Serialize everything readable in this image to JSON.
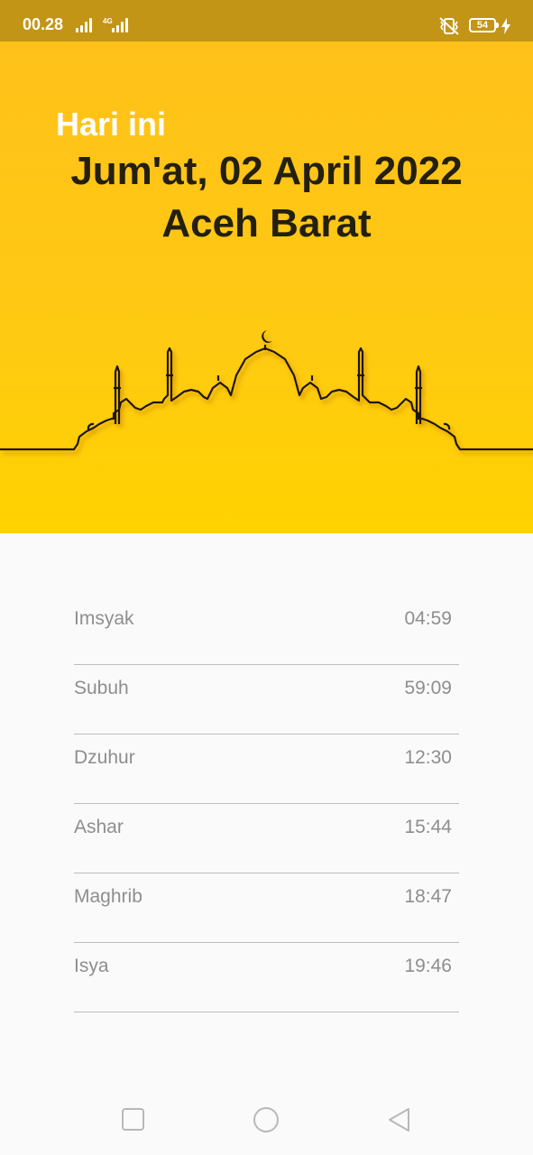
{
  "status_bar": {
    "time": "00.28",
    "network": "4G",
    "battery": "54"
  },
  "header": {
    "today_label": "Hari ini",
    "date": "Jum'at, 02 April 2022",
    "region": "Aceh Barat",
    "colors": {
      "background": "#ffc11a",
      "title": "#24200f"
    }
  },
  "prayers": [
    {
      "name": "Imsyak",
      "time": "04:59"
    },
    {
      "name": "Subuh",
      "time": "59:09"
    },
    {
      "name": "Dzuhur",
      "time": "12:30"
    },
    {
      "name": "Ashar",
      "time": "15:44"
    },
    {
      "name": "Maghrib",
      "time": "18:47"
    },
    {
      "name": "Isya",
      "time": "19:46"
    }
  ],
  "nav_bar": {
    "icons": [
      "recent-apps-icon",
      "home-icon",
      "back-icon"
    ]
  }
}
